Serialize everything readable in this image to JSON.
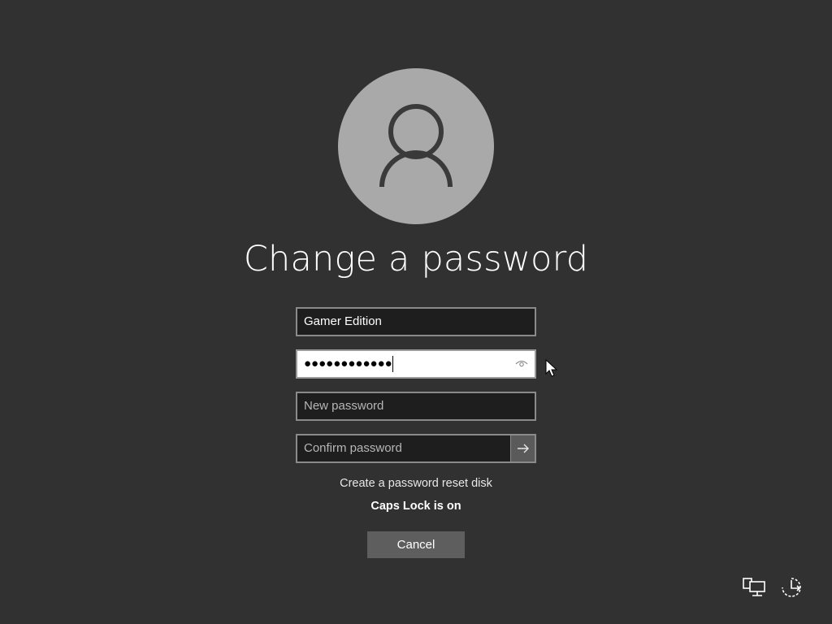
{
  "screen": {
    "title": "Change a password"
  },
  "form": {
    "username_value": "Gamer Edition",
    "current_password_mask": "●●●●●●●●●●●●",
    "new_password_placeholder": "New password",
    "confirm_password_placeholder": "Confirm password"
  },
  "links": {
    "reset_disk": "Create a password reset disk"
  },
  "status": {
    "caps_lock": "Caps Lock is on"
  },
  "buttons": {
    "cancel": "Cancel"
  },
  "icons": {
    "avatar": "user-silhouette-icon",
    "reveal": "eye-icon",
    "submit": "arrow-right-icon",
    "network": "network-icon",
    "power": "accessibility-power-icon"
  },
  "colors": {
    "background": "#313131",
    "avatar": "#a9a9a9",
    "field_bg": "#1e1e1e",
    "field_border": "#8a8a8a",
    "button": "#5e5e5e"
  }
}
